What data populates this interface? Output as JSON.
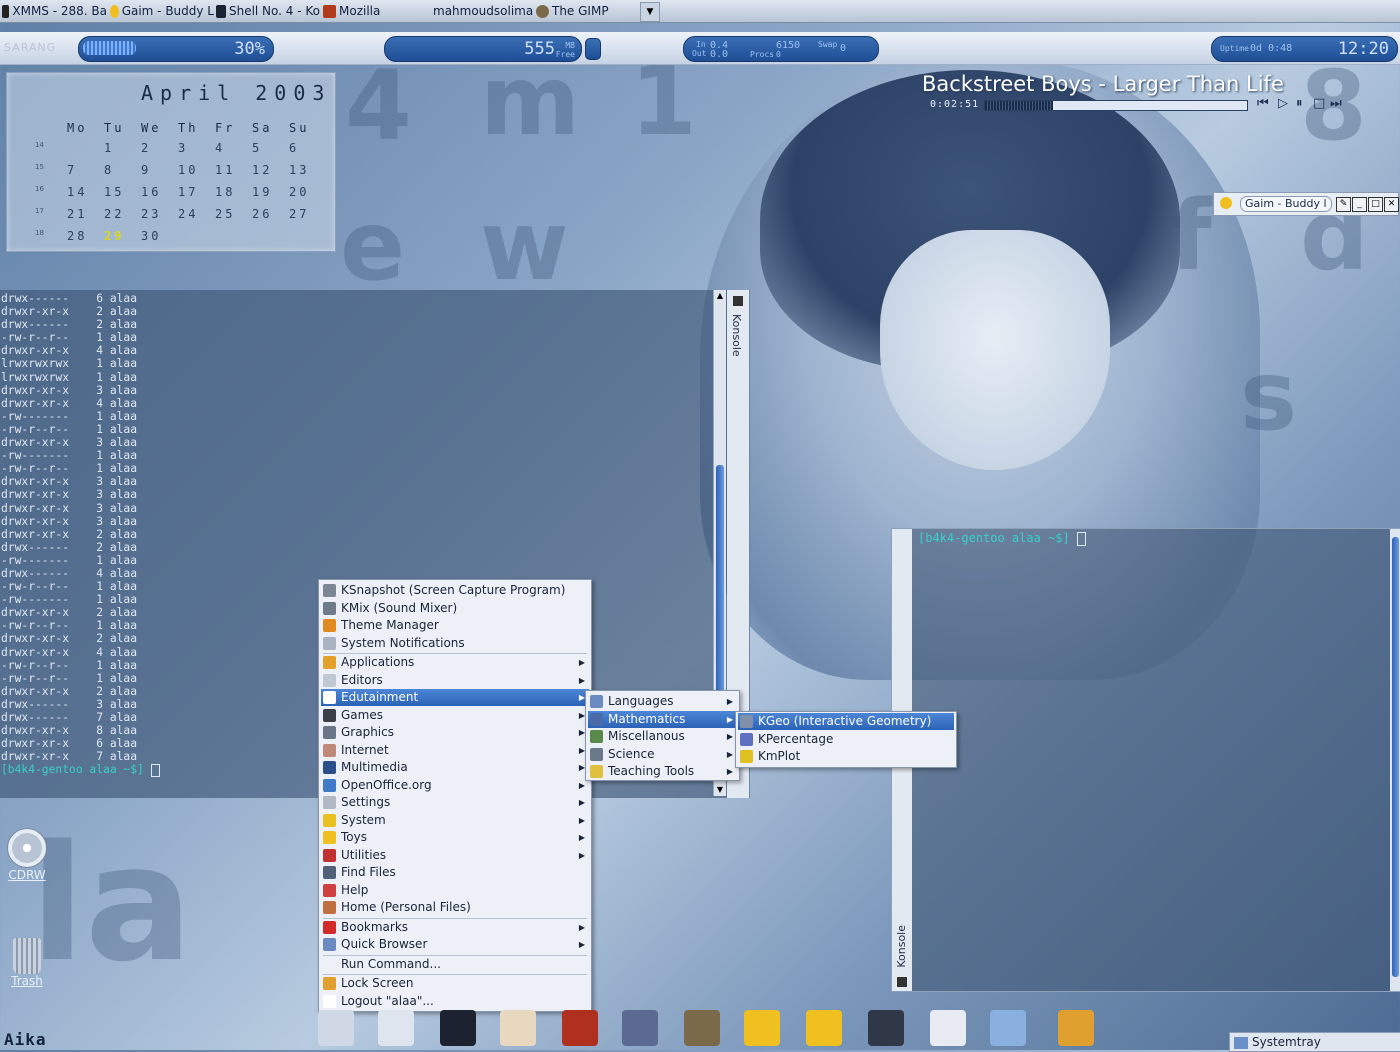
{
  "taskbar": {
    "tasks": [
      {
        "label": "XMMS - 288. Ba",
        "icon": "xmms-icon"
      },
      {
        "label": "Gaim - Buddy L",
        "icon": "gaim-icon"
      },
      {
        "label": "Shell No. 4 - Ko",
        "icon": "konsole-icon"
      },
      {
        "label": "Mozilla",
        "icon": "mozilla-icon"
      },
      {
        "label": "mahmoudsolima",
        "icon": "gaim-icon"
      },
      {
        "label": "The GIMP",
        "icon": "gimp-icon"
      }
    ]
  },
  "karamba": {
    "label": "SARANG",
    "cpu_percent": "30%",
    "cpu_fraction": 0.28,
    "mem_value": "555",
    "mem_unit": "MB",
    "mem_sub": "Free",
    "net_in": "In",
    "net_out": "Out",
    "net_in_val": "0.4",
    "net_out_val": "0.0",
    "procs_label": "Procs",
    "procs_val": "6150",
    "procs_sub": "0",
    "swap_label": "Swap",
    "swap_val": "0",
    "uptime_label": "Uptime",
    "uptime_val": "0d 0:48",
    "clock": "12:20"
  },
  "calendar": {
    "title": "April 2003",
    "weekdays": [
      "Mo",
      "Tu",
      "We",
      "Th",
      "Fr",
      "Sa",
      "Su"
    ],
    "weeks": [
      {
        "wk": "14",
        "days": [
          "",
          "1",
          "2",
          "3",
          "4",
          "5",
          "6"
        ]
      },
      {
        "wk": "15",
        "days": [
          "7",
          "8",
          "9",
          "10",
          "11",
          "12",
          "13"
        ]
      },
      {
        "wk": "16",
        "days": [
          "14",
          "15",
          "16",
          "17",
          "18",
          "19",
          "20"
        ]
      },
      {
        "wk": "17",
        "days": [
          "21",
          "22",
          "23",
          "24",
          "25",
          "26",
          "27"
        ]
      },
      {
        "wk": "18",
        "days": [
          "28",
          "29",
          "30",
          "",
          "",
          "",
          ""
        ]
      }
    ],
    "today": "29"
  },
  "xmms": {
    "title": "Backstreet Boys - Larger Than Life",
    "time": "0:02:51",
    "progress": 0.26
  },
  "gaim_mini": {
    "label": "Gaim - Buddy l"
  },
  "konsole1": {
    "side_label": "Konsole",
    "lines": [
      "drwx------    6 alaa",
      "drwxr-xr-x    2 alaa",
      "drwx------    2 alaa",
      "-rw-r--r--    1 alaa",
      "drwxr-xr-x    4 alaa",
      "lrwxrwxrwx    1 alaa",
      "lrwxrwxrwx    1 alaa",
      "drwxr-xr-x    3 alaa",
      "drwxr-xr-x    4 alaa",
      "-rw-------    1 alaa",
      "-rw-r--r--    1 alaa",
      "drwxr-xr-x    3 alaa",
      "-rw-------    1 alaa",
      "-rw-r--r--    1 alaa",
      "drwxr-xr-x    3 alaa",
      "drwxr-xr-x    3 alaa",
      "drwxr-xr-x    3 alaa",
      "drwxr-xr-x    3 alaa",
      "drwxr-xr-x    2 alaa",
      "drwx------    2 alaa",
      "-rw-------    1 alaa",
      "drwx------    4 alaa",
      "-rw-r--r--    1 alaa",
      "-rw-------    1 alaa",
      "drwxr-xr-x    2 alaa",
      "-rw-r--r--    1 alaa",
      "drwxr-xr-x    2 alaa",
      "drwxr-xr-x    4 alaa",
      "-rw-r--r--    1 alaa",
      "-rw-r--r--    1 alaa",
      "drwxr-xr-x    2 alaa",
      "drwx------    3 alaa",
      "drwx------    7 alaa",
      "drwxr-xr-x    8 alaa",
      "drwxr-xr-x    6 alaa",
      "drwxr-xr-x    7 alaa"
    ],
    "prompt": "[b4k4-gentoo alaa ~$] "
  },
  "konsole2": {
    "side_label": "Konsole",
    "prompt": "[b4k4-gentoo alaa ~$] "
  },
  "desktop_icons": [
    {
      "label": "CDRW",
      "icon": "cdrom-icon"
    },
    {
      "label": "Trash",
      "icon": "trash-icon"
    }
  ],
  "user_label": "Aika",
  "kmenu": {
    "groups": [
      [
        {
          "label": "KSnapshot (Screen Capture Program)",
          "icon": "camera-icon",
          "sub": false
        },
        {
          "label": "KMix (Sound Mixer)",
          "icon": "speaker-icon",
          "sub": false
        },
        {
          "label": "Theme Manager",
          "icon": "theme-icon",
          "sub": false
        },
        {
          "label": "System Notifications",
          "icon": "notification-icon",
          "sub": false
        }
      ],
      [
        {
          "label": "Applications",
          "icon": "applications-icon",
          "sub": true
        },
        {
          "label": "Editors",
          "icon": "editor-icon",
          "sub": true
        },
        {
          "label": "Edutainment",
          "icon": "edutainment-icon",
          "sub": true,
          "selected": true
        },
        {
          "label": "Games",
          "icon": "gamepad-icon",
          "sub": true
        },
        {
          "label": "Graphics",
          "icon": "graphics-icon",
          "sub": true
        },
        {
          "label": "Internet",
          "icon": "internet-icon",
          "sub": true
        },
        {
          "label": "Multimedia",
          "icon": "multimedia-icon",
          "sub": true
        },
        {
          "label": "OpenOffice.org",
          "icon": "openoffice-icon",
          "sub": true
        },
        {
          "label": "Settings",
          "icon": "settings-icon",
          "sub": true
        },
        {
          "label": "System",
          "icon": "warning-icon",
          "sub": true
        },
        {
          "label": "Toys",
          "icon": "toys-icon",
          "sub": true
        },
        {
          "label": "Utilities",
          "icon": "utilities-icon",
          "sub": true
        },
        {
          "label": "Find Files",
          "icon": "find-icon",
          "sub": false
        },
        {
          "label": "Help",
          "icon": "help-icon",
          "sub": false
        },
        {
          "label": "Home (Personal Files)",
          "icon": "home-icon",
          "sub": false
        }
      ],
      [
        {
          "label": "Bookmarks",
          "icon": "bookmark-icon",
          "sub": true
        },
        {
          "label": "Quick Browser",
          "icon": "browser-icon",
          "sub": true
        }
      ],
      [
        {
          "label": "Run Command...",
          "icon": "",
          "sub": false
        }
      ],
      [
        {
          "label": "Lock Screen",
          "icon": "lock-icon",
          "sub": false
        },
        {
          "label": "Logout \"alaa\"...",
          "icon": "logout-icon",
          "sub": false
        }
      ]
    ]
  },
  "edutainment_menu": [
    {
      "label": "Languages",
      "icon": "languages-icon",
      "sub": true
    },
    {
      "label": "Mathematics",
      "icon": "math-icon",
      "sub": true,
      "selected": true
    },
    {
      "label": "Miscellanous",
      "icon": "misc-icon",
      "sub": true
    },
    {
      "label": "Science",
      "icon": "science-icon",
      "sub": true
    },
    {
      "label": "Teaching Tools",
      "icon": "teaching-icon",
      "sub": true
    }
  ],
  "math_menu": [
    {
      "label": "KGeo (Interactive Geometry)",
      "icon": "geometry-icon",
      "selected": true
    },
    {
      "label": "KPercentage",
      "icon": "percent-icon"
    },
    {
      "label": "KmPlot",
      "icon": "plot-icon"
    }
  ],
  "panel": {
    "icons": [
      "kmenu-icon",
      "kde-icon",
      "terminal-icon",
      "home-icon",
      "mozilla-icon",
      "pen-icon",
      "gimp-icon",
      "gaim-icon",
      "folder-icon",
      "brush-icon",
      "calculator-icon",
      "monitor-icon",
      "lock-icon"
    ],
    "systray_label": "Systemtray"
  },
  "colors": {
    "accent": "#2b62b8",
    "prompt": "#39d0c8",
    "today": "#d8d820"
  }
}
